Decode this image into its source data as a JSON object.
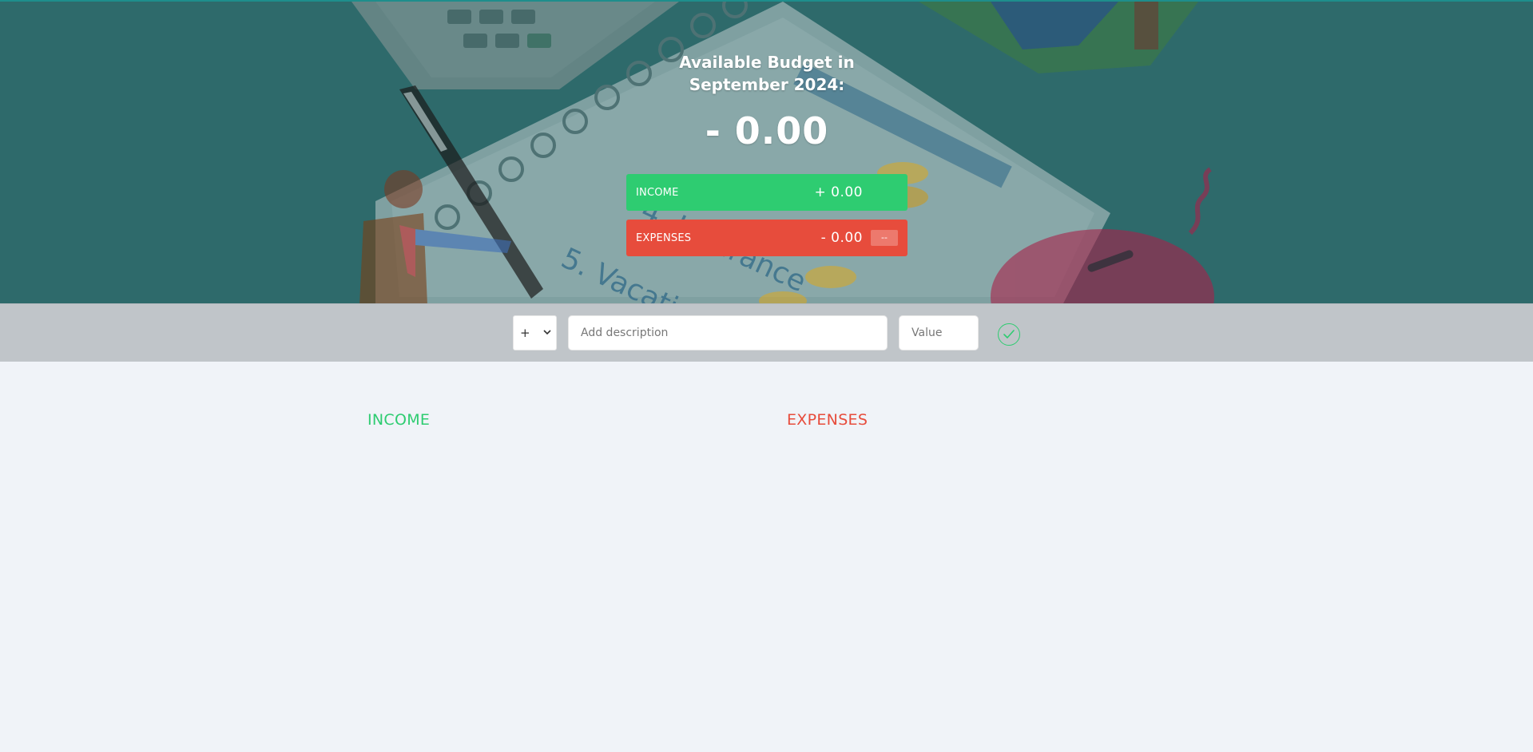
{
  "budget": {
    "title": "Available Budget in September 2024:",
    "value": "- 0.00"
  },
  "summary": {
    "income": {
      "label": "INCOME",
      "value": "+ 0.00"
    },
    "expenses": {
      "label": "EXPENSES",
      "value": "- 0.00",
      "percentage": "--"
    }
  },
  "add_form": {
    "type_options": [
      "+",
      "-"
    ],
    "selected_type": "+",
    "description_placeholder": "Add description",
    "value_placeholder": "Value",
    "submit_icon": "check-circle-icon"
  },
  "lists": {
    "income_title": "INCOME",
    "expenses_title": "EXPENSES"
  },
  "colors": {
    "income": "#2ecc71",
    "expenses": "#e74c3c",
    "header_bg": "#2e6a6b",
    "add_bar_bg": "#c0c5c9",
    "page_bg": "#f0f3f8"
  }
}
